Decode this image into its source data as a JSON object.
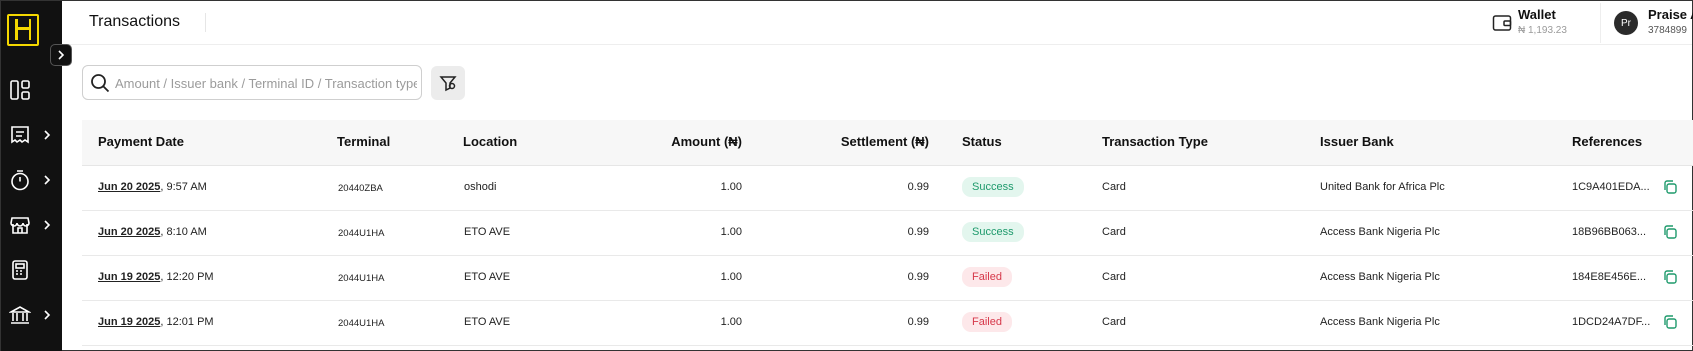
{
  "header": {
    "title": "Transactions",
    "wallet_label": "Wallet",
    "wallet_balance": "₦ 1,193.23",
    "user_initials": "Pr",
    "user_name": "Praise A",
    "user_id": "3784899"
  },
  "sidebar": {
    "items": [
      {
        "icon": "dashboard-icon",
        "has_chevron": false
      },
      {
        "icon": "receipt-icon",
        "has_chevron": true
      },
      {
        "icon": "timer-icon",
        "has_chevron": true
      },
      {
        "icon": "store-icon",
        "has_chevron": true
      },
      {
        "icon": "pos-terminal-icon",
        "has_chevron": false
      },
      {
        "icon": "bank-icon",
        "has_chevron": true
      }
    ]
  },
  "search": {
    "placeholder": "Amount / Issuer bank / Terminal ID / Transaction type",
    "value": ""
  },
  "table": {
    "columns": [
      "Payment Date",
      "Terminal",
      "Location",
      "Amount (₦)",
      "Settlement (₦)",
      "Status",
      "Transaction Type",
      "Issuer Bank",
      "References"
    ],
    "rows": [
      {
        "date": "Jun 20 2025",
        "time": ", 9:57 AM",
        "terminal": "20440ZBA",
        "location": "oshodi",
        "amount": "1.00",
        "settlement": "0.99",
        "status": "Success",
        "type": "Card",
        "bank": "United Bank for Africa Plc",
        "reference": "1C9A401EDA..."
      },
      {
        "date": "Jun 20 2025",
        "time": ", 8:10 AM",
        "terminal": "2044U1HA",
        "location": "ETO AVE",
        "amount": "1.00",
        "settlement": "0.99",
        "status": "Success",
        "type": "Card",
        "bank": "Access Bank Nigeria Plc",
        "reference": "18B96BB063..."
      },
      {
        "date": "Jun 19 2025",
        "time": ", 12:20 PM",
        "terminal": "2044U1HA",
        "location": "ETO AVE",
        "amount": "1.00",
        "settlement": "0.99",
        "status": "Failed",
        "type": "Card",
        "bank": "Access Bank Nigeria Plc",
        "reference": "184E8E456E..."
      },
      {
        "date": "Jun 19 2025",
        "time": ", 12:01 PM",
        "terminal": "2044U1HA",
        "location": "ETO AVE",
        "amount": "1.00",
        "settlement": "0.99",
        "status": "Failed",
        "type": "Card",
        "bank": "Access Bank Nigeria Plc",
        "reference": "1DCD24A7DF..."
      }
    ]
  },
  "colors": {
    "brand": "#f5d800",
    "sidebar_bg": "#111111",
    "success": "#1e9a6c",
    "failed": "#d6384a",
    "copy_icon": "#1e9a6c"
  }
}
